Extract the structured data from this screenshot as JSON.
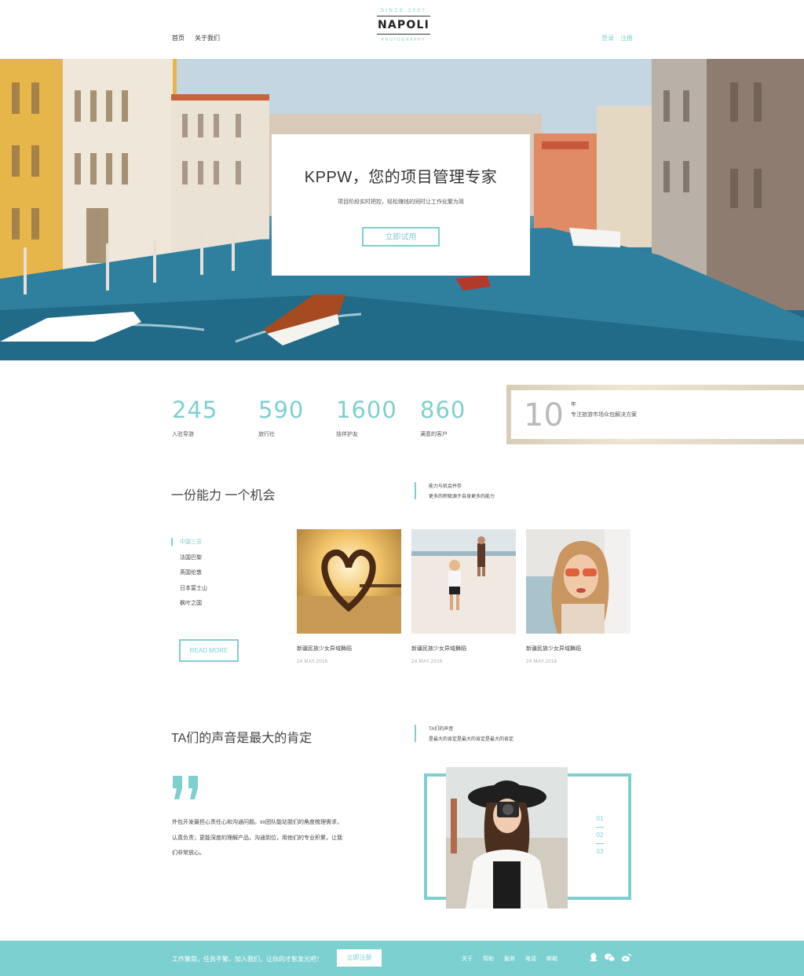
{
  "colors": {
    "accent": "#7fcfcf",
    "footer_bg": "#7dd0d0",
    "text": "#444444"
  },
  "header": {
    "nav_left": [
      "首页",
      "关于我们"
    ],
    "logo": {
      "since": "SINCE 2007",
      "brand": "NAPOLI",
      "sub": "PHOTOGRAPHY"
    },
    "nav_right": [
      "登录",
      "注册"
    ]
  },
  "hero": {
    "title": "KPPW，您的项目管理专家",
    "subtitle": "项目阶段实时把控，轻松赚钱的同时让工作化繁为简",
    "button": "立即试用"
  },
  "stats": [
    {
      "value": "245",
      "label": "入驻导游"
    },
    {
      "value": "590",
      "label": "旅行社"
    },
    {
      "value": "1600",
      "label": "拮伴护友"
    },
    {
      "value": "860",
      "label": "满意的客户"
    }
  ],
  "years": {
    "value": "10",
    "unit": "年",
    "desc": "专注旅游市场众包解决方案"
  },
  "section1": {
    "title": "一份能力  一个机会",
    "side_line1": "能力与机会并存",
    "side_line2": "更多的积极源于自身更多的能力",
    "destinations": [
      "中国三亚",
      "法国巴黎",
      "英国伦敦",
      "日本富士山",
      "枫叶之国"
    ],
    "read_more": "READ MORE",
    "cards": [
      {
        "title": "新疆民族少女异域舞蹈",
        "date": "24 MAY.2016",
        "image": "heart-silhouette-beach-photo"
      },
      {
        "title": "新疆民族少女异域舞蹈",
        "date": "24 MAY.2016",
        "image": "child-on-beach-photo"
      },
      {
        "title": "新疆民族少女异域舞蹈",
        "date": "24 MAY.2016",
        "image": "woman-sunglasses-photo"
      }
    ]
  },
  "section2": {
    "title": "TA们的声音是最大的肯定",
    "side_line1": "TA们的声音",
    "side_line2": "是最大的肯定是最大的肯定是最大的肯定",
    "quote_lines": [
      "外包开发最担心责任心和沟通问题。xx团队能站我们的角度梳理需求，",
      "认真负责；更能深度的理解产品，沟通到位，用他们的专业积累，让我",
      "们非常放心。"
    ],
    "pager": [
      "01",
      "02",
      "03"
    ]
  },
  "footer": {
    "text": "工作繁简，任务不繁，加入我们，让你的才智发光吧！",
    "button": "立即注册",
    "links": [
      "关于",
      "帮助",
      "服务",
      "电话",
      "邮箱"
    ],
    "social_icons": [
      "qq-icon",
      "wechat-icon",
      "weibo-icon"
    ]
  }
}
